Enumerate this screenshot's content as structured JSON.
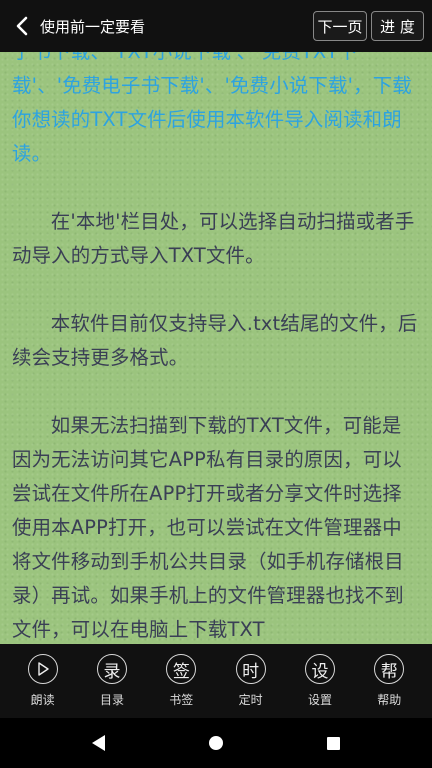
{
  "header": {
    "title": "使用前一定要看",
    "next_page": "下一页",
    "progress": "进 度"
  },
  "content": {
    "paragraphs": [
      "子书下载、'TXT小说下载'、'免费TXT下载'、'免费电子书下载'、'免费小说下载'，下载你想读的TXT文件后使用本软件导入阅读和朗读。",
      "在'本地'栏目处，可以选择自动扫描或者手动导入的方式导入TXT文件。",
      "本软件目前仅支持导入.txt结尾的文件，后续会支持更多格式。",
      "如果无法扫描到下载的TXT文件，可能是因为无法访问其它APP私有目录的原因，可以尝试在文件所在APP打开或者分享文件时选择使用本APP打开，也可以尝试在文件管理器中将文件移动到手机公共目录（如手机存储根目录）再试。如果手机上的文件管理器也找不到文件，可以在电脑上下载TXT"
    ]
  },
  "toolbar": {
    "items": [
      {
        "icon_char": "▷",
        "label": "朗读",
        "icon": "play-icon"
      },
      {
        "icon_char": "录",
        "label": "目录",
        "icon": "catalog-icon"
      },
      {
        "icon_char": "签",
        "label": "书签",
        "icon": "bookmark-icon"
      },
      {
        "icon_char": "时",
        "label": "定时",
        "icon": "timer-icon"
      },
      {
        "icon_char": "设",
        "label": "设置",
        "icon": "settings-icon"
      },
      {
        "icon_char": "帮",
        "label": "帮助",
        "icon": "help-icon"
      }
    ]
  },
  "colors": {
    "page_background": "#9bc47e",
    "body_text": "#3a3f55",
    "highlight_text": "#2da3e0",
    "bar_background": "#111111"
  }
}
